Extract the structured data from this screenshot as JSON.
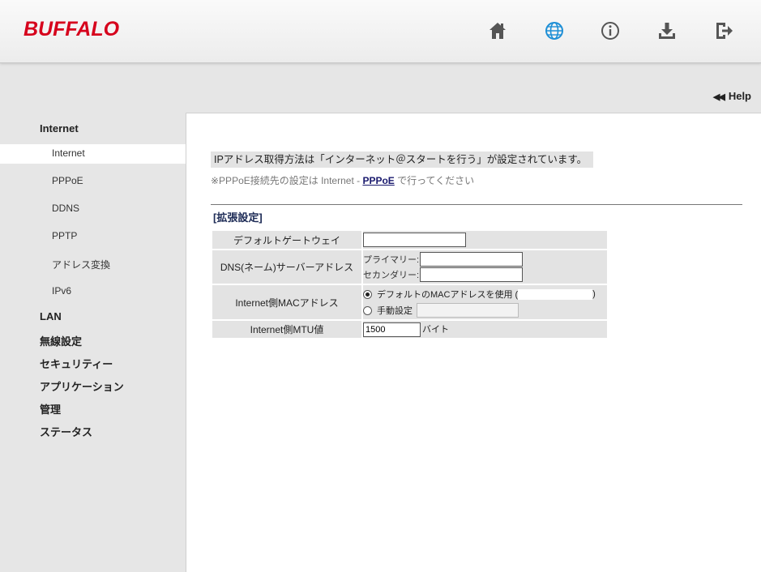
{
  "header": {
    "logo": "BUFFALO",
    "icons": [
      "home-icon",
      "globe-icon",
      "info-icon",
      "download-icon",
      "logout-icon"
    ]
  },
  "help": {
    "label": "Help"
  },
  "sidebar": {
    "sections": [
      {
        "label": "Internet",
        "items": [
          "Internet",
          "PPPoE",
          "DDNS",
          "PPTP",
          "アドレス変換",
          "IPv6"
        ]
      },
      {
        "label": "LAN"
      },
      {
        "label": "無線設定"
      },
      {
        "label": "セキュリティー"
      },
      {
        "label": "アプリケーション"
      },
      {
        "label": "管理"
      },
      {
        "label": "ステータス"
      }
    ],
    "active_item": "Internet"
  },
  "main": {
    "notice": "IPアドレス取得方法は「インターネット＠スタートを行う」が設定されています。",
    "note_prefix": "※PPPoE接続先の設定は Internet - ",
    "note_link": "PPPoE",
    "note_suffix": " で行ってください",
    "extended_title": "[拡張設定]",
    "rows": {
      "gateway": {
        "label": "デフォルトゲートウェイ",
        "value": ""
      },
      "dns": {
        "label": "DNS(ネーム)サーバーアドレス",
        "primary_label": "プライマリー:",
        "secondary_label": "セカンダリー:",
        "primary_value": "",
        "secondary_value": ""
      },
      "mac": {
        "label": "Internet側MACアドレス",
        "default_option": "デフォルトのMACアドレスを使用 (",
        "default_close": ")",
        "manual_option": "手動設定",
        "selected": "default"
      },
      "mtu": {
        "label": "Internet側MTU値",
        "value": "1500",
        "unit": "バイト"
      }
    }
  },
  "colors": {
    "logo": "#d6001c",
    "accent_icon": "#1e8fd6",
    "icon": "#555555"
  }
}
